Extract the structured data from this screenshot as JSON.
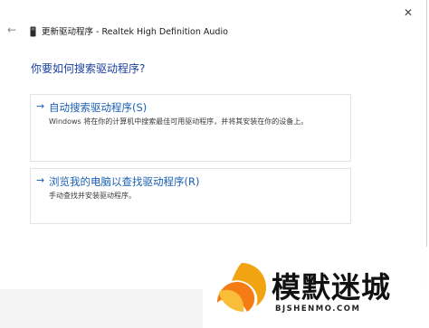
{
  "window": {
    "close_glyph": "✕",
    "back_glyph": "←",
    "title": "更新驱动程序 - Realtek High Definition Audio",
    "title_icon": "device-icon"
  },
  "main": {
    "question": "你要如何搜索驱动程序?",
    "options": [
      {
        "arrow": "→",
        "title": "自动搜索驱动程序(S)",
        "description": "Windows 将在你的计算机中搜索最佳可用驱动程序，并将其安装在你的设备上。"
      },
      {
        "arrow": "→",
        "title": "浏览我的电脑以查找驱动程序(R)",
        "description": "手动查找并安装驱动程序。"
      }
    ]
  },
  "watermark": {
    "name": "模默迷城",
    "url": "BJSHENMO.COM"
  },
  "colors": {
    "link_blue": "#1a5fb4",
    "heading_blue": "#1a3f9e"
  }
}
